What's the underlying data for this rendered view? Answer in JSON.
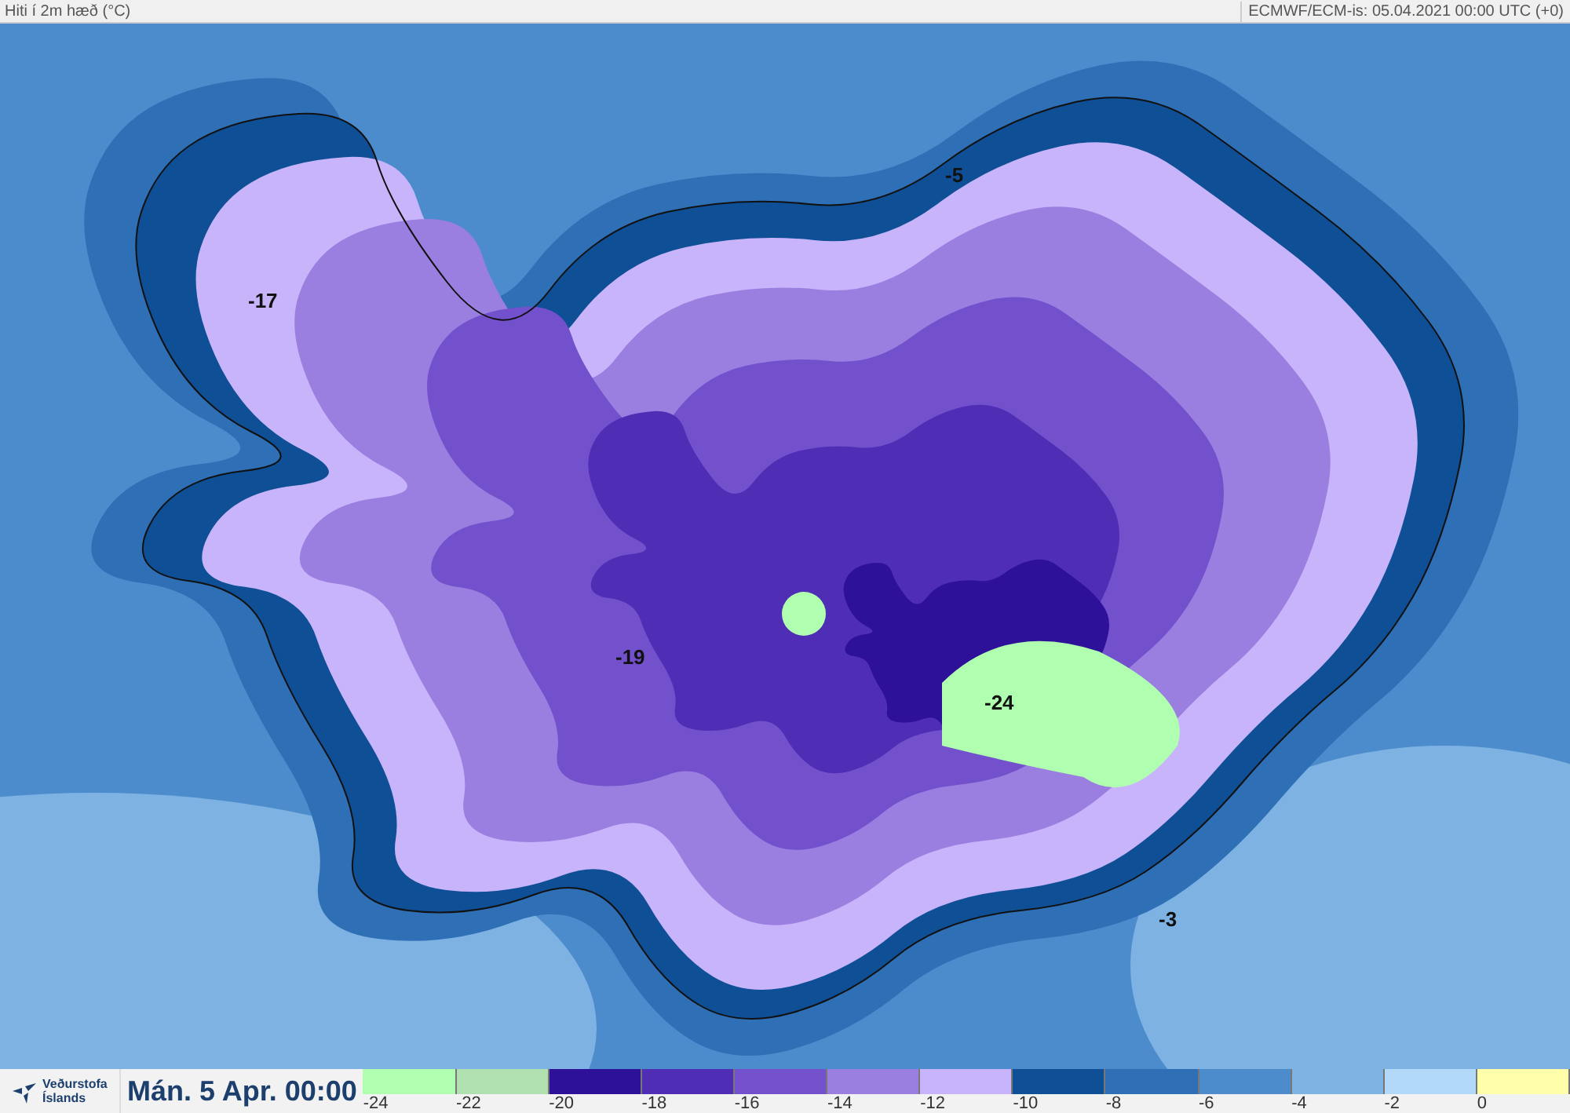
{
  "header": {
    "title": "Hiti í 2m hæð (°C)",
    "source": "ECMWF/ECM-is: 05.04.2021 00:00 UTC (+0)"
  },
  "map_labels": [
    "-5",
    "-17",
    "-19",
    "-24",
    "-3"
  ],
  "footer": {
    "logo_lines": [
      "Veðurstofa",
      "Íslands"
    ],
    "date": "Mán. 5 Apr. 00:00"
  },
  "legend": [
    {
      "label": "-24",
      "color": "#b0ffb0"
    },
    {
      "label": "-22",
      "color": "#b0e0b0"
    },
    {
      "label": "-20",
      "color": "#2e1199"
    },
    {
      "label": "-18",
      "color": "#4f2db5"
    },
    {
      "label": "-16",
      "color": "#7350cc"
    },
    {
      "label": "-14",
      "color": "#9b7fe0"
    },
    {
      "label": "-12",
      "color": "#c8b4fa"
    },
    {
      "label": "-10",
      "color": "#0f4f96"
    },
    {
      "label": "-8",
      "color": "#2e6fb5"
    },
    {
      "label": "-6",
      "color": "#4d8ccc"
    },
    {
      "label": "-4",
      "color": "#7eb2e3"
    },
    {
      "label": "-2",
      "color": "#b3d9fa"
    },
    {
      "label": "0",
      "color": "#ffffaa"
    }
  ]
}
